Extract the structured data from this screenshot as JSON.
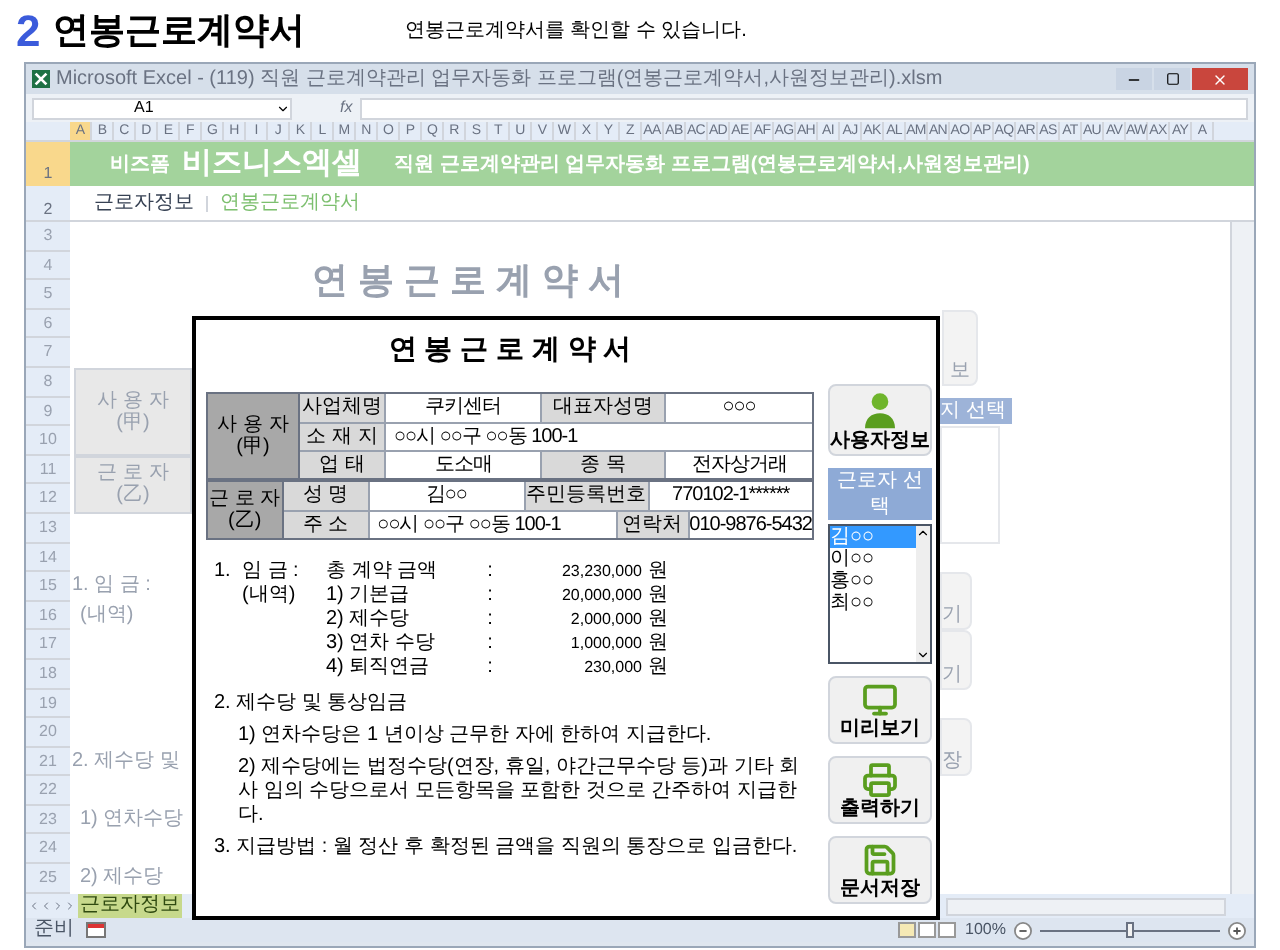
{
  "page_header": {
    "number": "2",
    "title": "연봉근로계약서",
    "description": "연봉근로계약서를 확인할 수 있습니다."
  },
  "window": {
    "title": "Microsoft Excel - (119) 직원 근로계약관리 업무자동화 프로그램(연봉근로계약서,사원정보관리).xlsm"
  },
  "formula_bar": {
    "name_box": "A1",
    "function_label": "fx"
  },
  "columns": [
    "A",
    "B",
    "C",
    "D",
    "E",
    "F",
    "G",
    "H",
    "I",
    "J",
    "K",
    "L",
    "M",
    "N",
    "O",
    "P",
    "Q",
    "R",
    "S",
    "T",
    "U",
    "V",
    "W",
    "X",
    "Y",
    "Z",
    "AA",
    "AB",
    "AC",
    "AD",
    "AE",
    "AF",
    "AG",
    "AH",
    "AI",
    "AJ",
    "AK",
    "AL",
    "AM",
    "AN",
    "AO",
    "AP",
    "AQ",
    "AR",
    "AS",
    "AT",
    "AU",
    "AV",
    "AW",
    "AX",
    "AY",
    "A"
  ],
  "rows": [
    "1",
    "2",
    "3",
    "4",
    "5",
    "6",
    "7",
    "8",
    "9",
    "10",
    "11",
    "12",
    "13",
    "14",
    "15",
    "16",
    "17",
    "18",
    "19",
    "20",
    "21",
    "22",
    "23",
    "24",
    "25"
  ],
  "banner": {
    "brand_small": "비즈폼",
    "brand": "비즈니스엑셀",
    "title": "직원 근로계약관리 업무자동화 프로그램(연봉근로계약서,사원정보관리)"
  },
  "nav_links": [
    {
      "label": "근로자정보",
      "selected": false
    },
    {
      "label": "연봉근로계약서",
      "selected": true
    }
  ],
  "sheet_background": {
    "title": "연 봉 근 로 계 약 서",
    "parties": [
      {
        "name": "사 용 자",
        "mark": "(甲)"
      },
      {
        "name": "근 로 자",
        "mark": "(乙)"
      }
    ],
    "left_lines": [
      "1.  임 금  :",
      "(내역)",
      "2.  제수당 및",
      "1) 연차수당",
      "2) 제수당"
    ],
    "right_fragments": {
      "user_button": "보",
      "list_header": "지 선택",
      "buttons": [
        "기",
        "기",
        "장"
      ]
    }
  },
  "dialog": {
    "title": "연 봉 근 로 계 약 서",
    "parties": [
      {
        "name": "사 용 자",
        "mark": "(甲)",
        "rows": [
          [
            {
              "kind": "head",
              "text": "사업체명"
            },
            {
              "kind": "value",
              "text": "쿠키센터"
            },
            {
              "kind": "subhead",
              "text": "대표자성명"
            },
            {
              "kind": "wide",
              "text": "○○○"
            }
          ],
          [
            {
              "kind": "head",
              "text": "소 재 지"
            },
            {
              "kind": "wide_left",
              "text": "○○시 ○○구 ○○동 100-1"
            }
          ],
          [
            {
              "kind": "head",
              "text": "업  태"
            },
            {
              "kind": "value",
              "text": "도소매"
            },
            {
              "kind": "subhead",
              "text": "종  목"
            },
            {
              "kind": "wide",
              "text": "전자상거래"
            }
          ]
        ]
      },
      {
        "name": "근 로 자",
        "mark": "(乙)",
        "rows": [
          [
            {
              "kind": "head",
              "text": "성  명"
            },
            {
              "kind": "value",
              "text": "김○○"
            },
            {
              "kind": "subhead",
              "text": "주민등록번호"
            },
            {
              "kind": "wide",
              "text": "770102-1******"
            }
          ],
          [
            {
              "kind": "head",
              "text": "주  소"
            },
            {
              "kind": "address",
              "text": "○○시 ○○구 ○○동 100-1"
            },
            {
              "kind": "subhead_narrow",
              "text": "연락처"
            },
            {
              "kind": "wide",
              "text": "010-9876-5432"
            }
          ]
        ]
      }
    ],
    "wage": [
      {
        "number": "1.",
        "head": "임 금  :",
        "label": "총 계약 금액",
        "sep": ":",
        "amount": "23,230,000",
        "unit": "원"
      },
      {
        "head": "(내역)",
        "label": "1) 기본급",
        "sep": ":",
        "amount": "20,000,000",
        "unit": "원"
      },
      {
        "label": "2) 제수당",
        "sep": ":",
        "amount": "2,000,000",
        "unit": "원"
      },
      {
        "label": "3) 연차 수당",
        "sep": ":",
        "amount": "1,000,000",
        "unit": "원"
      },
      {
        "label": "4) 퇴직연금",
        "sep": ":",
        "amount": "230,000",
        "unit": "원"
      }
    ],
    "sections": [
      {
        "kind": "heading",
        "text": "2.  제수당 및 통상임금"
      },
      {
        "kind": "item",
        "text": "1) 연차수당은 1 년이상 근무한 자에 한하여 지급한다."
      },
      {
        "kind": "item",
        "text": "2) 제수당에는 법정수당(연장, 휴일, 야간근무수당 등)과 기타 회사 임의 수당으로서 모든항목을 포함한 것으로 간주하여 지급한다."
      },
      {
        "kind": "heading",
        "text": "3.  지급방법  :  월 정산 후 확정된 금액을 직원의 통장으로 입금한다."
      }
    ],
    "user_button": "사용자정보",
    "list_header": "근로자 선택",
    "workers": [
      {
        "name": "김○○",
        "selected": true
      },
      {
        "name": "이○○",
        "selected": false
      },
      {
        "name": "홍○○",
        "selected": false
      },
      {
        "name": "최○○",
        "selected": false
      }
    ],
    "actions": [
      {
        "kind": "preview",
        "label": "미리보기"
      },
      {
        "kind": "print",
        "label": "출력하기"
      },
      {
        "kind": "save",
        "label": "문서저장"
      }
    ]
  },
  "sheet_tabs": [
    {
      "label": "근로자정보",
      "selected": true
    }
  ],
  "status_bar": {
    "ready": "준비",
    "zoom": "100%",
    "level": 0.5
  }
}
